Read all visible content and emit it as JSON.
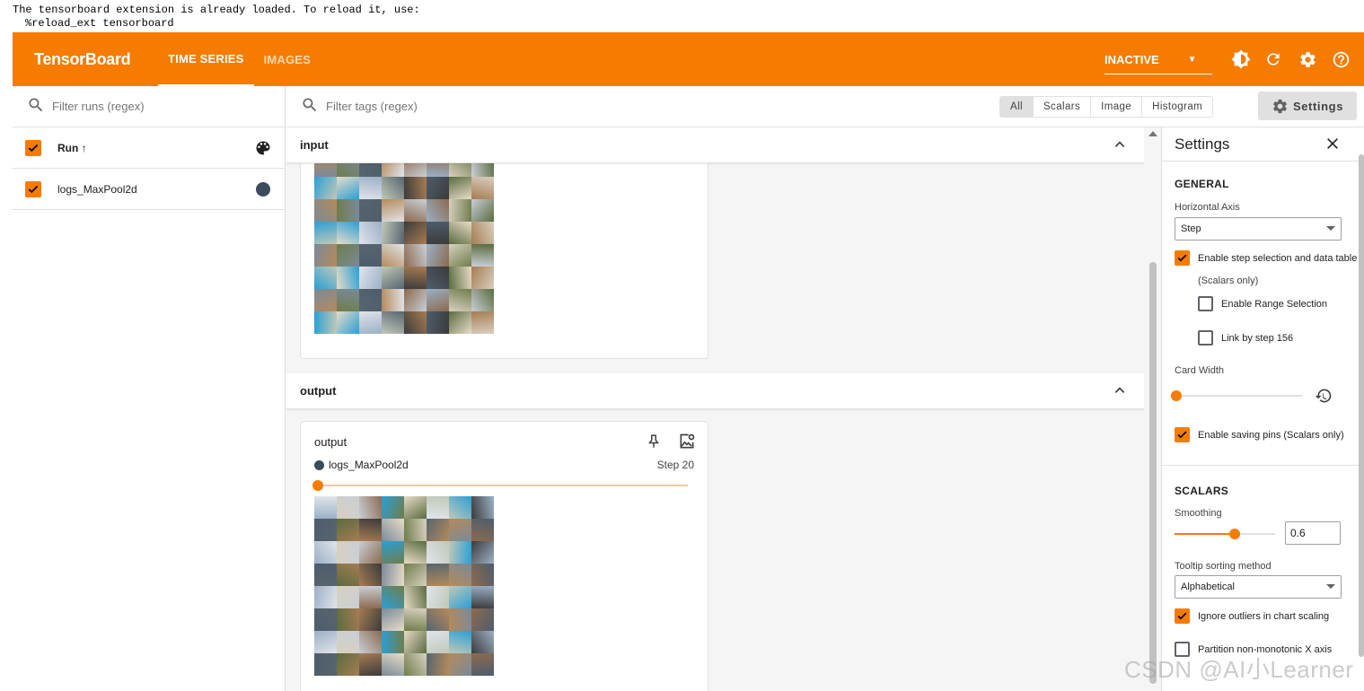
{
  "notebook_output": {
    "line1": "The tensorboard extension is already loaded. To reload it, use:",
    "line2": "%reload_ext tensorboard"
  },
  "topbar": {
    "brand": "TensorBoard",
    "tabs": [
      {
        "label": "TIME SERIES",
        "active": true
      },
      {
        "label": "IMAGES",
        "active": false
      }
    ],
    "run_status": "INACTIVE",
    "icons": [
      "brightness-icon",
      "refresh-icon",
      "gear-icon",
      "help-icon"
    ],
    "accent_color": "#f57c00"
  },
  "runs_pane": {
    "filter_placeholder": "Filter runs (regex)",
    "header_label": "Run ↑",
    "runs": [
      {
        "name": "logs_MaxPool2d",
        "checked": true,
        "color": "#3c4a5d"
      }
    ]
  },
  "tag_bar": {
    "filter_placeholder": "Filter tags (regex)",
    "type_filters": [
      "All",
      "Scalars",
      "Image",
      "Histogram"
    ],
    "selected_type": "All",
    "settings_label": "Settings"
  },
  "groups": [
    {
      "name": "input"
    },
    {
      "name": "output"
    }
  ],
  "output_card": {
    "title": "output",
    "run": "logs_MaxPool2d",
    "step": "Step 20"
  },
  "settings_panel": {
    "title": "Settings",
    "general": {
      "heading": "GENERAL",
      "horizontal_axis_label": "Horizontal Axis",
      "horizontal_axis_value": "Step",
      "enable_step_selection": "Enable step selection and data table",
      "scalars_only_note": "(Scalars only)",
      "enable_range_selection": "Enable Range Selection",
      "link_by_step": "Link by step 156",
      "card_width_label": "Card Width",
      "enable_saving_pins": "Enable saving pins (Scalars only)"
    },
    "scalars": {
      "heading": "SCALARS",
      "smoothing_label": "Smoothing",
      "smoothing_value": "0.6",
      "tooltip_sort_label": "Tooltip sorting method",
      "tooltip_sort_value": "Alphabetical",
      "ignore_outliers": "Ignore outliers in chart scaling",
      "partition_non_monotonic": "Partition non-monotonic X axis"
    }
  },
  "watermark": "CSDN @AI小Learner"
}
